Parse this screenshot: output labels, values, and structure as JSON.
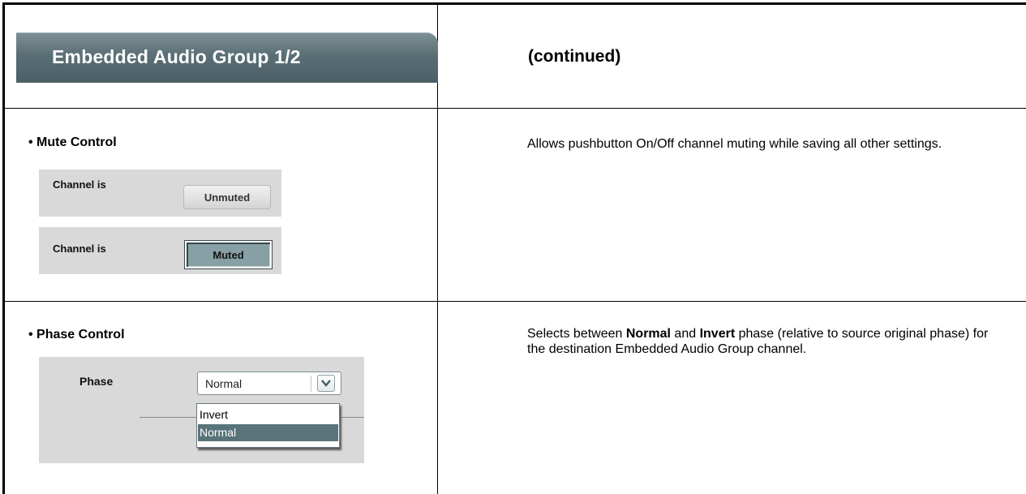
{
  "header": {
    "group_tab_label": "Embedded Audio Group 1/2",
    "continued_label": "(continued)"
  },
  "mute_control": {
    "title": "• Mute Control",
    "rows": [
      {
        "label": "Channel is",
        "button": "Unmuted",
        "state": "unmuted"
      },
      {
        "label": "Channel is",
        "button": "Muted",
        "state": "muted"
      }
    ],
    "description": "Allows pushbutton On/Off channel muting while saving all other settings."
  },
  "phase_control": {
    "title": "• Phase Control",
    "label": "Phase",
    "selected_value": "Normal",
    "options": [
      "Invert",
      "Normal"
    ],
    "highlighted_option": "Normal",
    "description": {
      "pre": "Selects between ",
      "bold1": "Normal",
      "mid": " and ",
      "bold2": "Invert",
      "post": " phase (relative to source original phase) for the destination Embedded Audio Group channel."
    }
  },
  "colors": {
    "tab_gradient_top": "#7e9095",
    "tab_gradient_bottom": "#4a6066",
    "muted_button": "#87a0a5",
    "selected_option": "#58747a",
    "panel_background": "#d9d9d9"
  }
}
